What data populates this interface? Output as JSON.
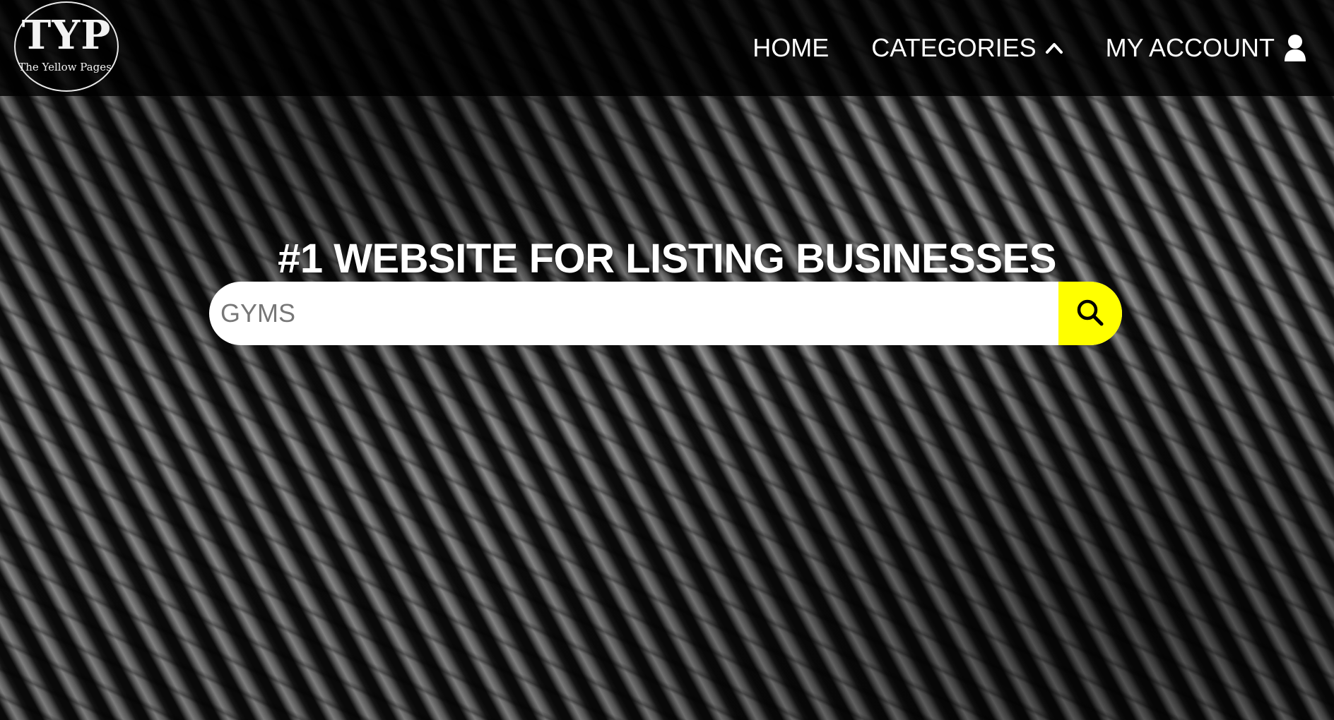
{
  "logo": {
    "mark": "TYP",
    "tagline": "The Yellow Pages"
  },
  "nav": {
    "items": [
      {
        "label": "HOME",
        "icon": null
      },
      {
        "label": "CATEGORIES",
        "icon": "chevron-up-icon"
      },
      {
        "label": "MY ACCOUNT",
        "icon": "user-icon"
      }
    ]
  },
  "hero": {
    "title": "#1 WEBSITE FOR LISTING BUSINESSES"
  },
  "search": {
    "placeholder": "GYMS",
    "value": "",
    "button_icon": "search-icon"
  },
  "colors": {
    "accent": "#ffff00",
    "header_bg": "#000000",
    "text": "#ffffff"
  }
}
